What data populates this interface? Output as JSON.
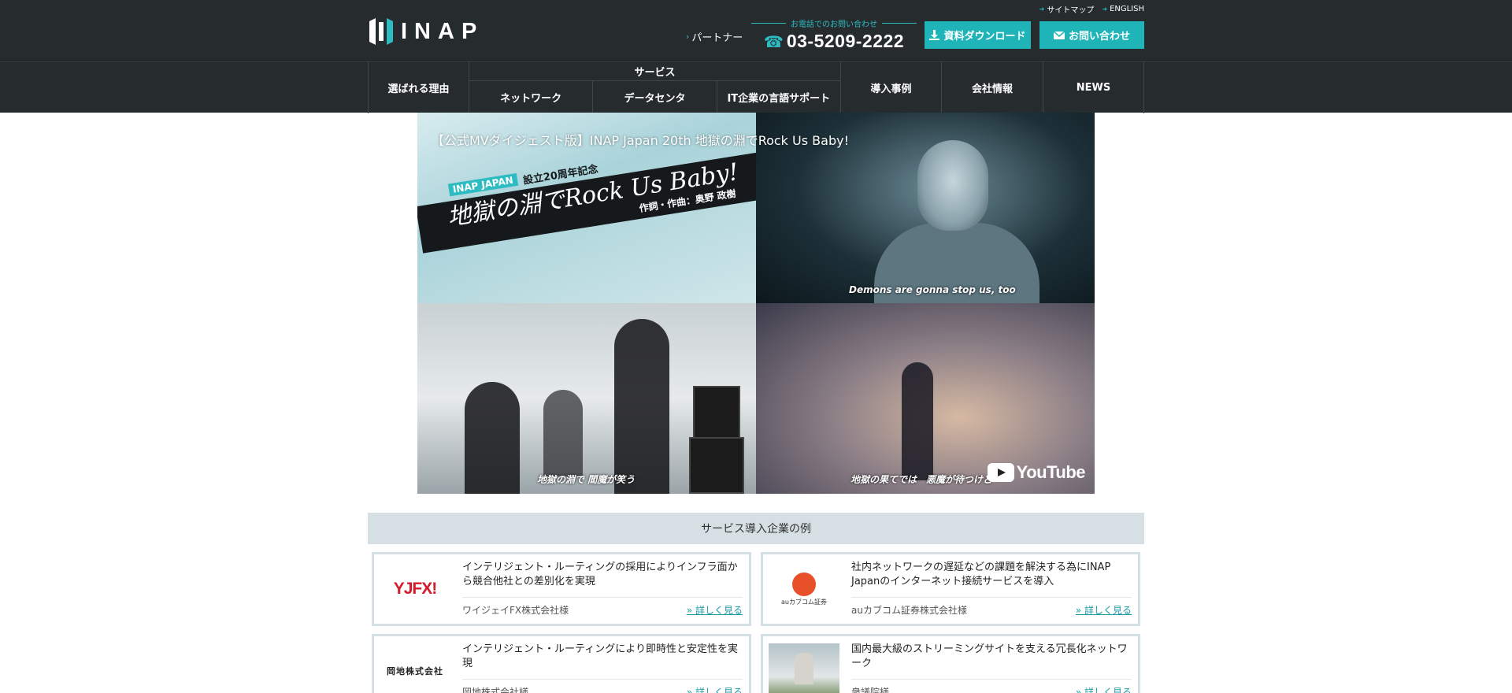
{
  "header": {
    "logo_text": "INAP",
    "top_links": [
      {
        "label": "サイトマップ"
      },
      {
        "label": "ENGLISH"
      }
    ],
    "partner_label": "パートナー",
    "phone_caption": "お電話でのお問い合わせ",
    "phone_number": "03-5209-2222",
    "download_label": "資料ダウンロード",
    "contact_label": "お問い合わせ"
  },
  "nav": {
    "reasons": "選ばれる理由",
    "service_group": "サービス",
    "service_items": [
      "ネットワーク",
      "データセンタ",
      "IT企業の言語サポート"
    ],
    "cases": "導入事例",
    "company": "会社情報",
    "news": "NEWS"
  },
  "video": {
    "title": "【公式MVダイジェスト版】INAP Japan 20th 地獄の淵でRock Us Baby!",
    "badge_brand": "INAP JAPAN",
    "badge_anniv": "設立20周年記念",
    "song_title": "地獄の淵でRock Us Baby!",
    "credit": "作詞・作曲：奥野 政樹",
    "subtitle_tr": "Demons are gonna stop us, too",
    "subtitle_bl": "地獄の淵で 閻魔が笑う",
    "subtitle_br": "地獄の果てでは　悪魔が待つけど",
    "youtube_label": "YouTube"
  },
  "cases": {
    "heading": "サービス導入企業の例",
    "items": [
      {
        "logo": "YJFX!",
        "title": "インテリジェント・ルーティングの採用によりインフラ面から競合他社との差別化を実現",
        "company": "ワイジェイFX株式会社様",
        "more": "» 詳しく見る"
      },
      {
        "logo": "auカブコム証券",
        "title": "社内ネットワークの遅延などの課題を解決する為にINAP Japanのインターネット接続サービスを導入",
        "company": "auカブコム証券株式会社様",
        "more": "» 詳しく見る"
      },
      {
        "logo": "岡地株式会社",
        "title": "インテリジェント・ルーティングにより即時性と安定性を実現",
        "company": "岡地株式会社様",
        "more": "» 詳しく見る"
      },
      {
        "logo": "",
        "title": "国内最大級のストリーミングサイトを支える冗長化ネットワーク",
        "company": "衆議院様",
        "more": "» 詳しく見る"
      }
    ]
  },
  "colors": {
    "header_bg": "#262b2e",
    "accent": "#1fb5b8",
    "case_border": "#d6dfe3"
  }
}
